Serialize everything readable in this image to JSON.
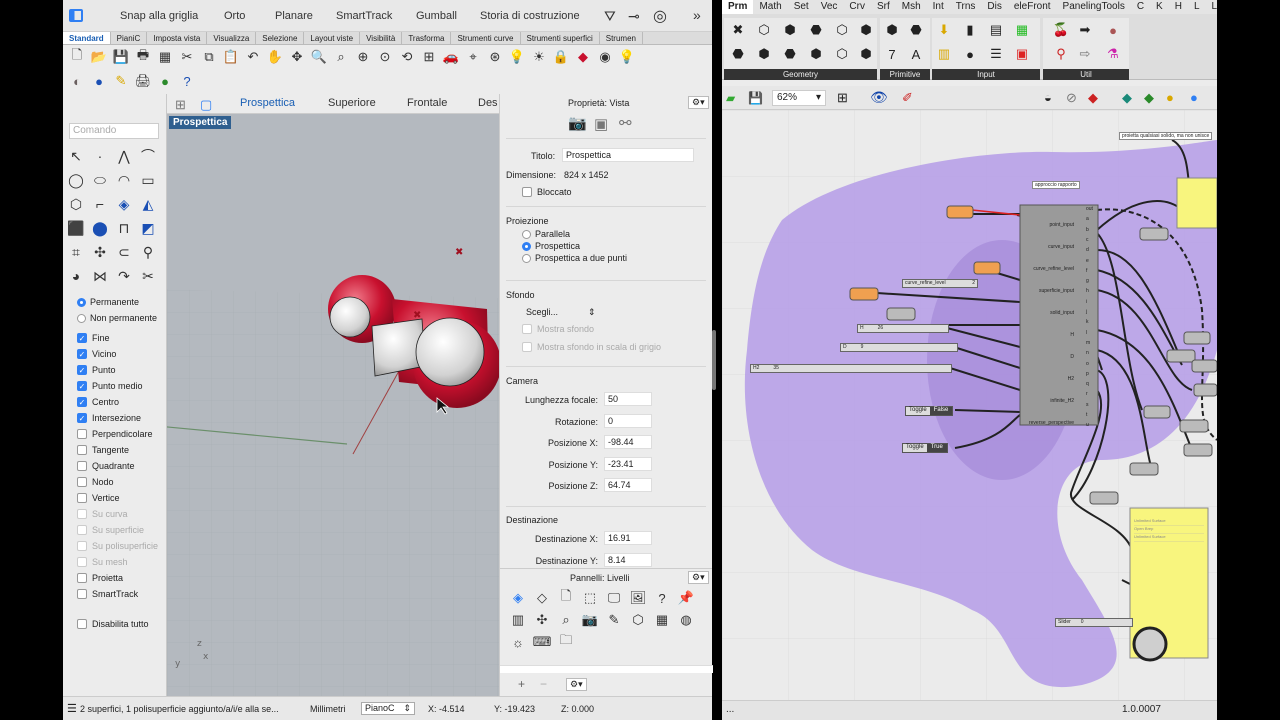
{
  "rhino": {
    "topbar": {
      "items": [
        "Snap alla griglia",
        "Orto",
        "Planare",
        "SmartTrack",
        "Gumball",
        "Storia di costruzione"
      ]
    },
    "tabs": [
      "Standard",
      "PianiC",
      "Imposta vista",
      "Visualizza",
      "Selezione",
      "Layout viste",
      "Visibilità",
      "Trasforma",
      "Strumenti curve",
      "Strumenti superfici",
      "Strumen"
    ],
    "command_placeholder": "Comando",
    "snaps": {
      "mode": [
        {
          "label": "Permanente",
          "on": true
        },
        {
          "label": "Non permanente",
          "on": false
        }
      ],
      "items": [
        {
          "label": "Fine",
          "on": true
        },
        {
          "label": "Vicino",
          "on": true
        },
        {
          "label": "Punto",
          "on": true
        },
        {
          "label": "Punto medio",
          "on": true
        },
        {
          "label": "Centro",
          "on": true
        },
        {
          "label": "Intersezione",
          "on": true
        },
        {
          "label": "Perpendicolare",
          "on": false
        },
        {
          "label": "Tangente",
          "on": false
        },
        {
          "label": "Quadrante",
          "on": false
        },
        {
          "label": "Nodo",
          "on": false
        },
        {
          "label": "Vertice",
          "on": false
        },
        {
          "label": "Su curva",
          "on": false,
          "disabled": true
        },
        {
          "label": "Su superficie",
          "on": false,
          "disabled": true
        },
        {
          "label": "Su polisuperficie",
          "on": false,
          "disabled": true
        },
        {
          "label": "Su mesh",
          "on": false,
          "disabled": true
        },
        {
          "label": "Proietta",
          "on": false
        },
        {
          "label": "SmartTrack",
          "on": false
        }
      ],
      "disable_all": "Disabilita tutto"
    },
    "view_tabs": [
      "Prospettica",
      "Superiore",
      "Frontale",
      "Des"
    ],
    "viewport_label": "Prospettica",
    "properties": {
      "header": "Proprietà: Vista",
      "titolo_label": "Titolo:",
      "titolo_value": "Prospettica",
      "dimensione_label": "Dimensione:",
      "dimensione_value": "824 x 1452",
      "bloccato": "Bloccato",
      "proiezione_label": "Proiezione",
      "projection": [
        {
          "label": "Parallela",
          "on": false
        },
        {
          "label": "Prospettica",
          "on": true
        },
        {
          "label": "Prospettica a due punti",
          "on": false
        }
      ],
      "sfondo_label": "Sfondo",
      "scegli": "Scegli...",
      "mostra_sfondo": "Mostra sfondo",
      "mostra_grigio": "Mostra sfondo in scala di grigio",
      "camera_label": "Camera",
      "camera": [
        {
          "label": "Lunghezza focale:",
          "value": "50"
        },
        {
          "label": "Rotazione:",
          "value": "0"
        },
        {
          "label": "Posizione X:",
          "value": "-98.44"
        },
        {
          "label": "Posizione Y:",
          "value": "-23.41"
        },
        {
          "label": "Posizione Z:",
          "value": "64.74"
        }
      ],
      "destinazione_label": "Destinazione",
      "destinazione": [
        {
          "label": "Destinazione X:",
          "value": "16.91"
        },
        {
          "label": "Destinazione Y:",
          "value": "8.14"
        }
      ]
    },
    "layers_header": "Pannelli: Livelli",
    "status": {
      "message": "2 superfici, 1 polisuperficie aggiunto/a/i/e alla se...",
      "units": "Millimetri",
      "layer": "PianoC",
      "x": "X: -4.514",
      "y": "Y: -19.423",
      "z": "Z: 0.000"
    }
  },
  "gh": {
    "menu": [
      "Prm",
      "Math",
      "Set",
      "Vec",
      "Crv",
      "Srf",
      "Msh",
      "Int",
      "Trns",
      "Dis",
      "eleFront",
      "PanelingTools",
      "C",
      "K",
      "H",
      "L",
      "L"
    ],
    "groups": [
      "Geometry",
      "Primitive",
      "Input",
      "Util"
    ],
    "zoom": "62%",
    "status_left": "...",
    "version": "1.0.0007",
    "note_top": "proietta qualsiasi solido, ma non unisce",
    "note_group": "approccio rapporto",
    "inputs": [
      "point_input",
      "curve_input",
      "curve_refine_level",
      "superficie_input",
      "solid_input",
      "H",
      "D",
      "H2",
      "infinite_H2",
      "reverse_perspective"
    ],
    "outputs": [
      "out",
      "a",
      "b",
      "c",
      "d",
      "e",
      "f",
      "g",
      "h",
      "i",
      "j",
      "k",
      "l",
      "m",
      "n",
      "o",
      "p",
      "q",
      "r",
      "s",
      "t",
      "u"
    ],
    "sliders": [
      {
        "label": "curve_refine_level",
        "value": "2"
      },
      {
        "label": "H",
        "value": "26"
      },
      {
        "label": "D",
        "value": "9"
      },
      {
        "label": "H2",
        "value": "35"
      },
      {
        "label": "Slider",
        "value": "0"
      }
    ],
    "toggles": [
      {
        "label": "Toggle",
        "value": "False"
      },
      {
        "label": "Toggle",
        "value": "True"
      }
    ],
    "panel_lines": [
      "Unlimited Surface",
      "Open Brep",
      "Unlimited Surface"
    ]
  },
  "colors": {
    "accent": "#2f7ff3",
    "gh_group": "#b59ce8",
    "gh_panel": "#f8f57e",
    "red": "#c8102e"
  }
}
